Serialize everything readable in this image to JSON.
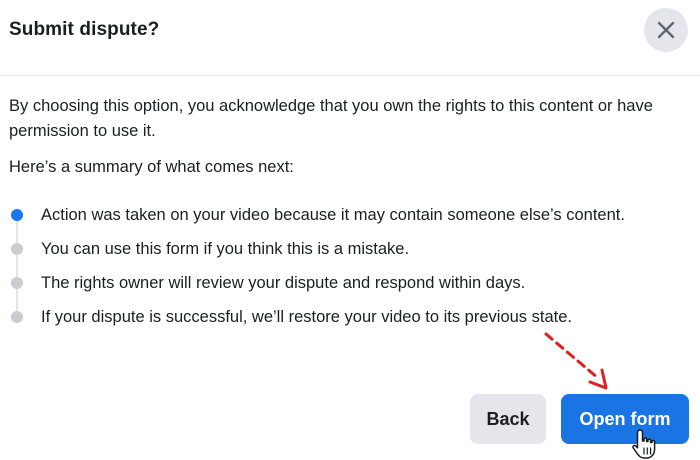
{
  "dialog": {
    "title": "Submit dispute?",
    "close_icon": "close-icon",
    "intro_text": "By choosing this option, you acknowledge that you own the rights to this content or have permission to use it.",
    "summary_heading": "Here’s a summary of what comes next:",
    "steps": [
      {
        "label": "Action was taken on your video because it may contain someone else’s content.",
        "active": true
      },
      {
        "label": "You can use this form if you think this is a mistake.",
        "active": false
      },
      {
        "label": "The rights owner will review your dispute and respond within days.",
        "active": false
      },
      {
        "label": "If your dispute is successful, we’ll restore your video to its previous state.",
        "active": false
      }
    ],
    "back_label": "Back",
    "open_form_label": "Open form"
  },
  "colors": {
    "primary_button": "#1b74e4",
    "active_step": "#1877f2",
    "inactive_step": "#c9ccd1",
    "secondary_button": "#e4e6eb",
    "annotation_arrow": "#e02020"
  },
  "annotations": {
    "arrow_icon": "dashed-arrow-icon",
    "cursor_icon": "hand-pointer-icon"
  }
}
